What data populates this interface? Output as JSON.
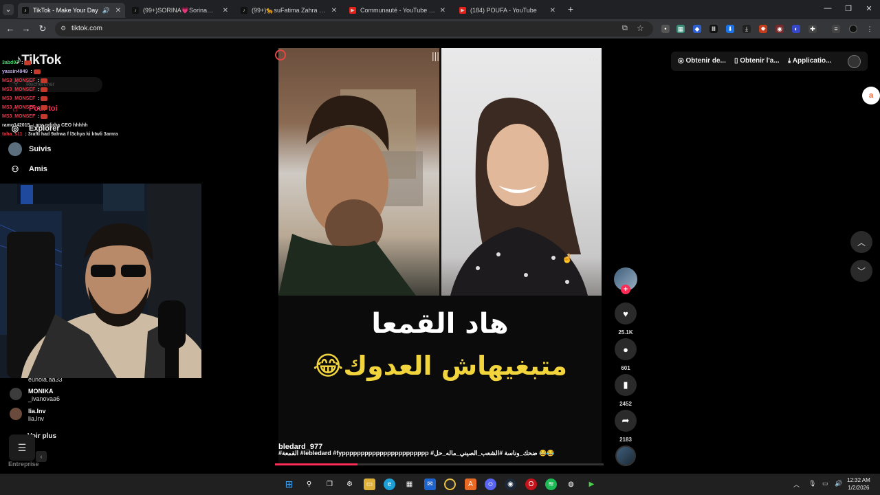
{
  "tabs": [
    {
      "label": "TikTok - Make Your Day",
      "icon": "tiktok-icon",
      "active": true
    },
    {
      "label": "(99+)SORINA💗Sorina💗 (@so",
      "icon": "tiktok-icon",
      "active": false
    },
    {
      "label": "(99+)🐆suFatima Zahra su🐆 (",
      "icon": "tiktok-icon",
      "active": false
    },
    {
      "label": "Communauté - YouTube Studio",
      "icon": "youtube-icon",
      "active": false
    },
    {
      "label": "(184) POUFA - YouTube",
      "icon": "youtube-icon",
      "active": false
    }
  ],
  "address": {
    "url": "tiktok.com"
  },
  "sidebar": {
    "logo": "TikTok",
    "search_placeholder": "Rechercher",
    "items": [
      {
        "label": "Pour toi",
        "icon": "home-icon"
      },
      {
        "label": "Explorer",
        "icon": "compass-icon"
      },
      {
        "label": "Suivis",
        "icon": "following-icon"
      },
      {
        "label": "Amis",
        "icon": "friends-icon"
      }
    ],
    "accounts": [
      {
        "name": "",
        "handle": "eunola.aa33"
      },
      {
        "name": "MONIKA",
        "handle": "_ivanovaa6"
      },
      {
        "name": "lia.lnv",
        "handle": "lia.lnv"
      }
    ],
    "see_more": "Voir plus",
    "footer": "Entreprise"
  },
  "chat": [
    {
      "user": "3abd07",
      "text": "",
      "color": "#4bd66b",
      "emote": true
    },
    {
      "user": "yassin4949",
      "text": "",
      "color": "#c8a8ff",
      "emote": true
    },
    {
      "user": "MS3_MONSEF",
      "text": "",
      "color": "#e03b4a",
      "emote": true
    },
    {
      "user": "MS3_MONSEF",
      "text": "",
      "color": "#e03b4a",
      "emote": true
    },
    {
      "user": "MS3_MONSEF",
      "text": "",
      "color": "#e03b4a",
      "emote": true
    },
    {
      "user": "MS3_MONSEF",
      "text": "",
      "color": "#e03b4a",
      "emote": true
    },
    {
      "user": "MS3_MONSEF",
      "text": "",
      "color": "#e03b4a",
      "emote": true
    },
    {
      "user": "ramo142015",
      "text": "ana ndirha CEO hhhhh",
      "color": "#dddddd",
      "emote": false
    },
    {
      "user": "taha_s11",
      "text": "3rafti had 9ahwa f l3chya ki ktwli 3amra",
      "color": "#e03b4a",
      "emote": false
    }
  ],
  "video": {
    "caption_line1": "هاد القمعا",
    "caption_line2": "متبغيهاش العدوك😂",
    "author": "bledard_977",
    "tags": "#القمعة #lebledard #fyppppppppppppppppppppppp #ضحك_وناسة #الشعب_الصيني_ماله_حل 😂😂",
    "progress": 0.25
  },
  "actions": {
    "likes": "25.1K",
    "comments": "601",
    "saves": "2452",
    "shares": "2183"
  },
  "topbar": {
    "coins": "Obtenir de...",
    "app": "Obtenir l'a...",
    "desktop": "Applicatio..."
  },
  "taskbar": {
    "time": "12:32 AM",
    "date": "1/2/2026"
  },
  "colors": {
    "accent": "#fe2c55",
    "caption_yellow": "#f2d43c"
  }
}
